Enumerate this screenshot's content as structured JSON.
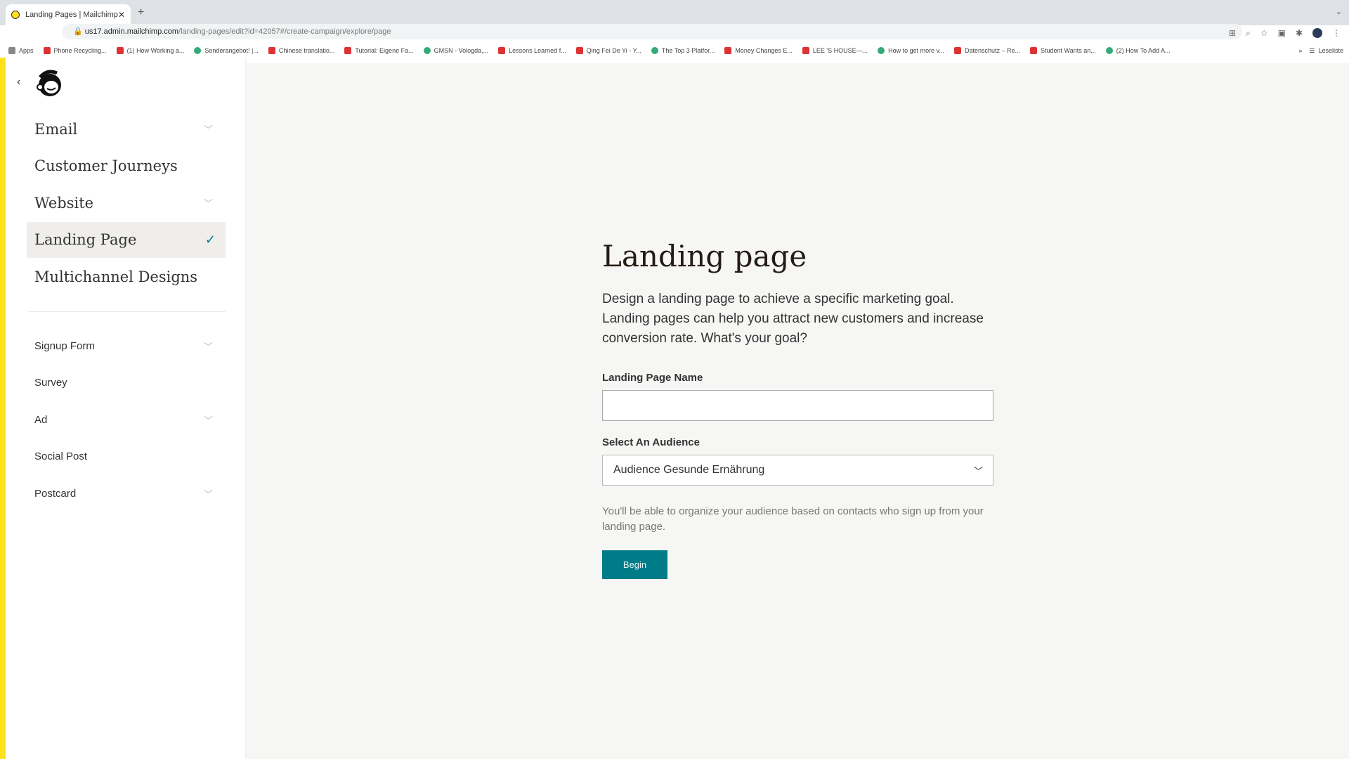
{
  "browser": {
    "tab_title": "Landing Pages | Mailchimp",
    "url_host": "us17.admin.mailchimp.com",
    "url_path": "/landing-pages/edit?id=42057#/create-campaign/explore/page",
    "bookmarks": [
      "Apps",
      "Phone Recycling...",
      "(1) How Working a...",
      "Sonderangebot! |...",
      "Chinese translatio...",
      "Tutorial: Eigene Fa...",
      "GMSN - Vologda,...",
      "Lessons Learned f...",
      "Qing Fei De Yi - Y...",
      "The Top 3 Platfor...",
      "Money Changes E...",
      "LEE 'S HOUSE—...",
      "How to get more v...",
      "Datenschutz – Re...",
      "Student Wants an...",
      "(2) How To Add A..."
    ],
    "reading_list": "Leseliste"
  },
  "sidebar": {
    "primary": [
      {
        "label": "Email",
        "expandable": true
      },
      {
        "label": "Customer Journeys",
        "expandable": false
      },
      {
        "label": "Website",
        "expandable": true
      },
      {
        "label": "Landing Page",
        "selected": true
      },
      {
        "label": "Multichannel Designs",
        "expandable": false
      }
    ],
    "secondary": [
      {
        "label": "Signup Form",
        "expandable": true
      },
      {
        "label": "Survey",
        "expandable": false
      },
      {
        "label": "Ad",
        "expandable": true
      },
      {
        "label": "Social Post",
        "expandable": false
      },
      {
        "label": "Postcard",
        "expandable": true
      }
    ]
  },
  "main": {
    "title": "Landing page",
    "description": "Design a landing page to achieve a specific marketing goal. Landing pages can help you attract new customers and increase conversion rate. What's your goal?",
    "name_label": "Landing Page Name",
    "name_value": "",
    "audience_label": "Select An Audience",
    "audience_value": "Audience Gesunde Ernährung",
    "help": "You'll be able to organize your audience based on contacts who sign up from your landing page.",
    "begin": "Begin"
  },
  "colors": {
    "brand_yellow": "#ffe01b",
    "accent": "#007c89"
  }
}
